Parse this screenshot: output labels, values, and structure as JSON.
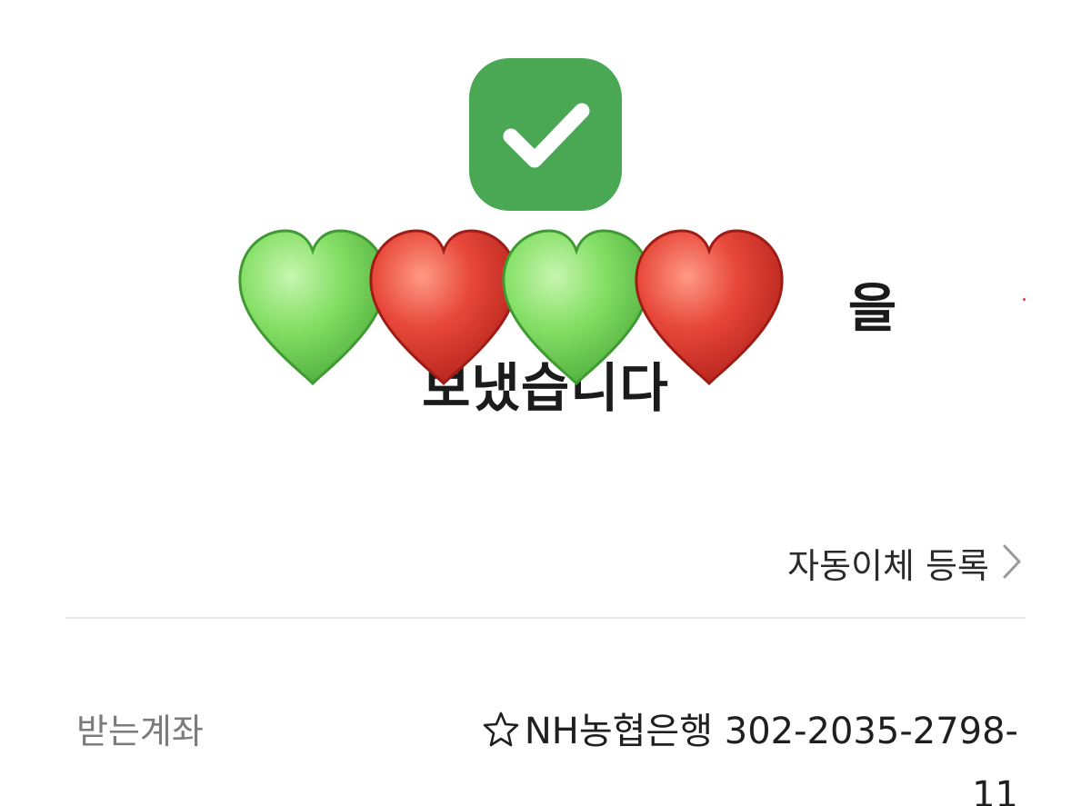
{
  "success": {
    "icon": "check-icon",
    "color": "#4aa855",
    "title_line1": "을",
    "title_line2": "보냈습니다"
  },
  "overlay": {
    "hearts": [
      "green-heart-icon",
      "red-heart-icon",
      "green-heart-icon",
      "red-heart-icon"
    ],
    "colors": {
      "green": "#7ed957",
      "red": "#e03a2f"
    }
  },
  "auto_transfer": {
    "label": "자동이체 등록",
    "icon": "chevron-right-icon"
  },
  "receiving_account": {
    "label": "받는계좌",
    "favorite_icon": "star-outline-icon",
    "bank": "NH농협은행",
    "number_line1": "302-2035-2798-",
    "number_line2": "11"
  }
}
